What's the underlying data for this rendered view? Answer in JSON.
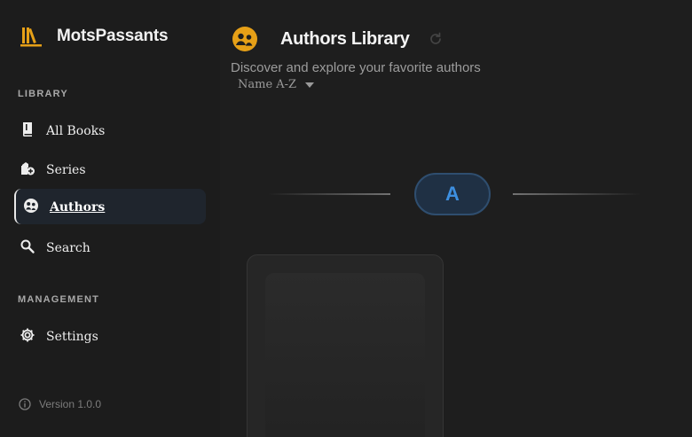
{
  "brand": {
    "name": "MotsPassants",
    "icon": "books-icon",
    "color": "#e6a017"
  },
  "sidebar": {
    "library_label": "LIBRARY",
    "management_label": "MANAGEMENT",
    "items": [
      {
        "label": "All Books",
        "icon": "book-icon",
        "active": false
      },
      {
        "label": "Series",
        "icon": "series-icon",
        "active": false
      },
      {
        "label": "Authors",
        "icon": "authors-icon",
        "active": true
      },
      {
        "label": "Search",
        "icon": "search-icon",
        "active": false
      }
    ],
    "management_items": [
      {
        "label": "Settings",
        "icon": "gear-icon",
        "active": false
      }
    ],
    "version": "Version 1.0.0"
  },
  "main": {
    "title": "Authors Library",
    "subtitle": "Discover and explore your favorite authors",
    "sort": {
      "selected": "Name A-Z"
    },
    "group_letter": "A"
  },
  "colors": {
    "accent": "#e6a017",
    "letter": "#3d8fe0",
    "background": "#1e1e1e",
    "sidebar_active": "#1f252d"
  }
}
